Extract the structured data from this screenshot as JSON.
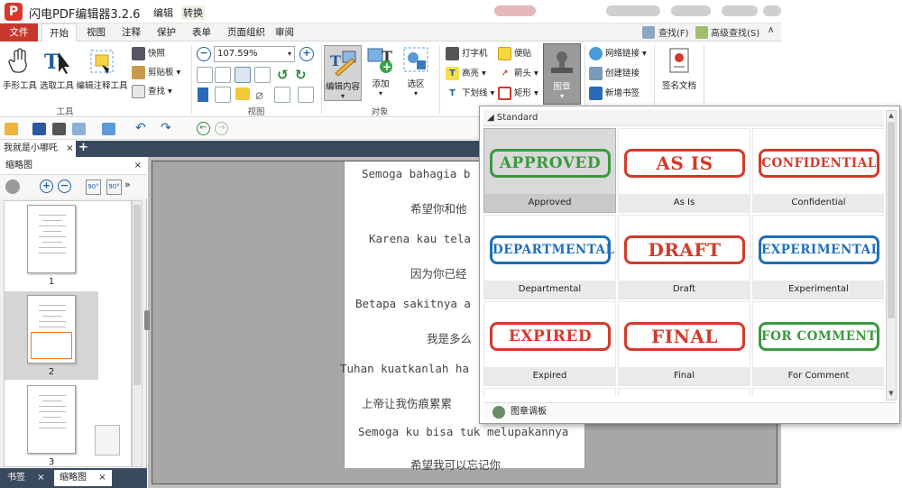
{
  "app": {
    "title": "闪电PDF编辑器3.2.6",
    "title_tabs": [
      "编辑",
      "转换"
    ]
  },
  "menu": {
    "tabs": [
      "文件",
      "开始",
      "视图",
      "注释",
      "保护",
      "表单",
      "页面组织",
      "审阅"
    ],
    "search": "查找(F)",
    "advanced_search": "高级查找(S)",
    "collapse": "∧"
  },
  "ribbon": {
    "tools": {
      "hand": "手形工具",
      "select": "选取工具",
      "annot": "编辑注释工具",
      "group": "工具"
    },
    "clip": {
      "snapshot": "快照",
      "clipboard": "剪贴板",
      "find": "查找"
    },
    "view": {
      "zoom": "107.59%",
      "group": "视图"
    },
    "object": {
      "edit": "编辑内容",
      "add": "添加",
      "select": "选区",
      "group": "对象"
    },
    "annot": {
      "typewriter": "打字机",
      "note": "便贴",
      "highlight": "高亮",
      "arrow": "箭头",
      "underline": "下划线",
      "rect": "矩形"
    },
    "stamp": "图章",
    "links": {
      "web": "网络链接",
      "create": "创建链接",
      "bookmark": "新增书签"
    },
    "sign": "签名文档"
  },
  "doc": {
    "tab": "我就是小哪吒",
    "tab_close": "×"
  },
  "left_panel": {
    "title": "缩略图",
    "close": "×",
    "pages": [
      "1",
      "2",
      "3"
    ],
    "bottom_tabs": [
      "书签",
      "缩略图"
    ]
  },
  "document_lines": [
    "Semoga bahagia b",
    "希望你和他",
    "Karena kau tela",
    "因为你已经",
    "Betapa sakitnya a",
    "我是多么",
    "Tuhan kuatkanlah ha",
    "上帝让我伤痕累累",
    "Semoga ku bisa tuk melupakannya",
    "希望我可以忘记你"
  ],
  "stamp_popup": {
    "header": "Standard",
    "footer": "图章调板",
    "stamps": [
      {
        "text": "APPROVED",
        "label": "Approved",
        "color": "#3a9a3f"
      },
      {
        "text": "AS IS",
        "label": "As Is",
        "color": "#d23a2a"
      },
      {
        "text": "CONFIDENTIAL",
        "label": "Confidential",
        "color": "#d23a2a"
      },
      {
        "text": "DEPARTMENTAL",
        "label": "Departmental",
        "color": "#1f6fb8"
      },
      {
        "text": "DRAFT",
        "label": "Draft",
        "color": "#d23a2a"
      },
      {
        "text": "EXPERIMENTAL",
        "label": "Experimental",
        "color": "#1f6fb8"
      },
      {
        "text": "EXPIRED",
        "label": "Expired",
        "color": "#d23a2a"
      },
      {
        "text": "FINAL",
        "label": "Final",
        "color": "#d23a2a"
      },
      {
        "text": "FOR COMMENT",
        "label": "For Comment",
        "color": "#3a9a3f"
      }
    ]
  },
  "colors": {
    "accent": "#c8372d",
    "dark_tab": "#3a4a5e"
  }
}
